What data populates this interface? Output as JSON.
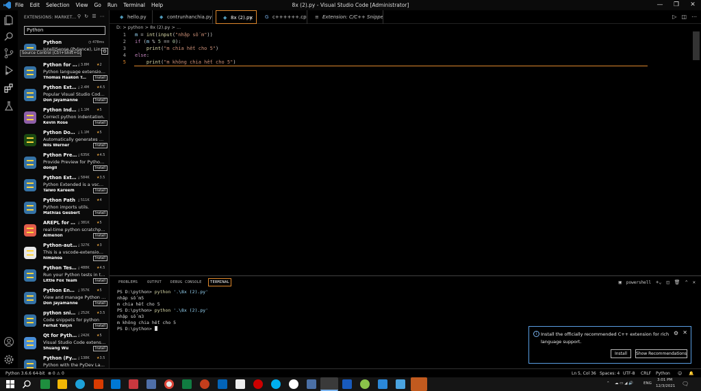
{
  "window": {
    "title": "8x (2).py - Visual Studio Code [Administrator]",
    "menu": [
      "File",
      "Edit",
      "Selection",
      "View",
      "Go",
      "Run",
      "Terminal",
      "Help"
    ]
  },
  "sidebar": {
    "header": "EXTENSIONS: MARKET...",
    "search_value": "Python",
    "tooltip": "Source Control (Ctrl+Shift+G)",
    "extensions": [
      {
        "name": "Python",
        "downloads": "",
        "rating": "478ms",
        "desc": "IntelliSense (Pylance), Lintin...",
        "publisher": "Microsoft",
        "installed": true
      },
      {
        "name": "Python for V...",
        "downloads": "3.8M",
        "rating": "2",
        "desc": "Python language extension ...",
        "publisher": "Thomas Haakon Tow...",
        "install": "Install"
      },
      {
        "name": "Python Exte...",
        "downloads": "2.4M",
        "rating": "4.5",
        "desc": "Popular Visual Studio Code ...",
        "publisher": "Don Jayamanne",
        "install": "Install"
      },
      {
        "name": "Python Indent",
        "downloads": "1.1M",
        "rating": "5",
        "desc": "Correct python indentation.",
        "publisher": "Kevin Rose",
        "install": "Install"
      },
      {
        "name": "Python Docst...",
        "downloads": "1.1M",
        "rating": "5",
        "desc": "Automatically generates det...",
        "publisher": "Nils Werner",
        "install": "Install"
      },
      {
        "name": "Python Prev...",
        "downloads": "635K",
        "rating": "4.5",
        "desc": "Provide Preview for Python ...",
        "publisher": "dongli",
        "install": "Install"
      },
      {
        "name": "Python Exte...",
        "downloads": "584K",
        "rating": "3.5",
        "desc": "Python Extended is a vscod...",
        "publisher": "Taiwo Kareem",
        "install": "Install"
      },
      {
        "name": "Python Path",
        "downloads": "511K",
        "rating": "4",
        "desc": "Python imports utils.",
        "publisher": "Mathias Gesbert",
        "install": "Install"
      },
      {
        "name": "AREPL for pyt...",
        "downloads": "381K",
        "rating": "5",
        "desc": "real-time python scratchpad",
        "publisher": "Almenon",
        "install": "Install"
      },
      {
        "name": "Python-auto...",
        "downloads": "327K",
        "rating": "3",
        "desc": "This is a vscode-extension t...",
        "publisher": "himanoa",
        "install": "Install"
      },
      {
        "name": "Python Test ...",
        "downloads": "488K",
        "rating": "4.5",
        "desc": "Run your Python tests in the...",
        "publisher": "Little Fox Team",
        "install": "Install"
      },
      {
        "name": "Python Envir...",
        "downloads": "357K",
        "rating": "5",
        "desc": "View and manage Python e...",
        "publisher": "Don Jayamanne",
        "install": "Install"
      },
      {
        "name": "python snip...",
        "downloads": "252K",
        "rating": "3.5",
        "desc": "Code snippets for python",
        "publisher": "Ferhat Yalçın",
        "install": "Install"
      },
      {
        "name": "Qt for Python",
        "downloads": "242K",
        "rating": "5",
        "desc": "Visual Studio Code extensio...",
        "publisher": "Shuang Wu",
        "install": "Install"
      },
      {
        "name": "Python (PyD...",
        "downloads": "138K",
        "rating": "3.5",
        "desc": "Python with the PyDev Lang...",
        "publisher": "",
        "install": ""
      }
    ]
  },
  "tabs": [
    {
      "label": "hello.py"
    },
    {
      "label": "contrunhanchia.py"
    },
    {
      "label": "8x (2).py",
      "close": "×"
    },
    {
      "label": "c++++++.cpp"
    },
    {
      "label": "Extension: C/C++ Snippets"
    }
  ],
  "breadcrumb": "D: > python > 8x (2).py > ...",
  "editor": {
    "line_numbers": [
      "1",
      "2",
      "3",
      "4",
      "5"
    ]
  },
  "panel": {
    "tabs": [
      "PROBLEMS",
      "OUTPUT",
      "DEBUG CONSOLE",
      "TERMINAL"
    ],
    "shell": "powershell",
    "terminal": {
      "prompt1": "PS D:\\python> ",
      "cmd1": "python",
      "arg1": " '.\\8x (2).py'",
      "out1": "nhập số m5",
      "out2": "m chia hết cho 5",
      "prompt2": "PS D:\\python> ",
      "cmd2": "python",
      "arg2": " '.\\8x (2).py'",
      "out3": "nhập số m3",
      "out4": "m không chia hết cho 5",
      "prompt3": "PS D:\\python> "
    }
  },
  "notification": {
    "message": "Install the officially recommended C++ extension for rich language support.",
    "install": "Install",
    "recommendations": "Show Recommendations"
  },
  "statusbar": {
    "interpreter": "Python 3.6.6 64-bit",
    "problems": "⊗ 0 ⚠ 0",
    "position": "Ln 5, Col 36",
    "spaces": "Spaces: 4",
    "encoding": "UTF-8",
    "eol": "CRLF",
    "language": "Python"
  },
  "taskbar": {
    "lang": "ENG",
    "time": "3:01 PM",
    "date": "12/3/2021"
  }
}
